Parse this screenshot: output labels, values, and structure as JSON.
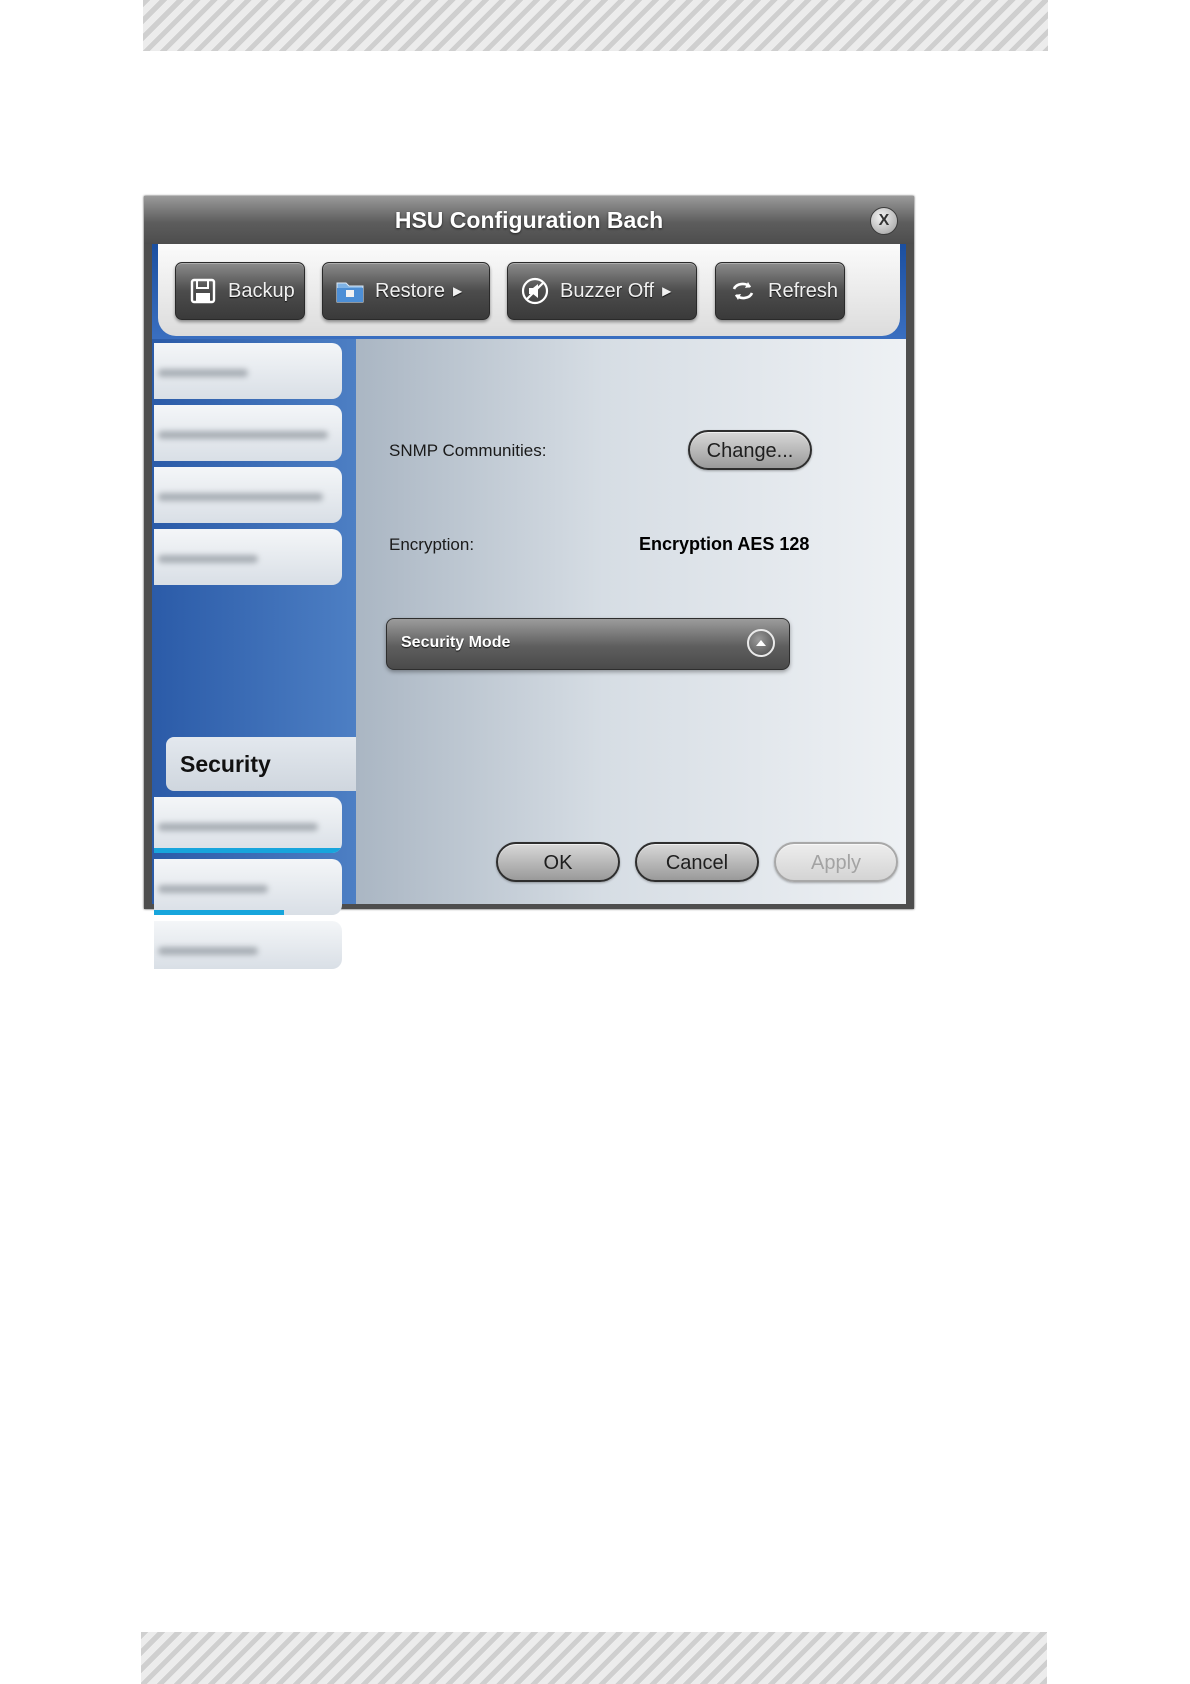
{
  "window": {
    "title": "HSU Configuration Bach",
    "close_label": "X"
  },
  "toolbar": {
    "buttons": [
      {
        "label": "Backup",
        "icon": "save-icon"
      },
      {
        "label": "Restore",
        "icon": "folder-icon",
        "has_menu": true
      },
      {
        "label": "Buzzer Off",
        "icon": "speaker-mute-icon",
        "has_menu": true
      },
      {
        "label": "Refresh",
        "icon": "refresh-icon"
      }
    ]
  },
  "sidebar": {
    "active_item": "Security",
    "hidden_items_note": "other navigation items are blurred in the original"
  },
  "content": {
    "snmp_label": "SNMP Communities:",
    "change_button": "Change...",
    "encryption_label": "Encryption:",
    "encryption_value": "Encryption AES 128",
    "security_mode_label": "Security Mode"
  },
  "footer": {
    "ok": "OK",
    "cancel": "Cancel",
    "apply": "Apply",
    "apply_enabled": false
  },
  "colors": {
    "title_bar": "#5d5d5d",
    "sidebar_blue": "#2b5ba8",
    "nav_accent": "#17a5dc"
  }
}
